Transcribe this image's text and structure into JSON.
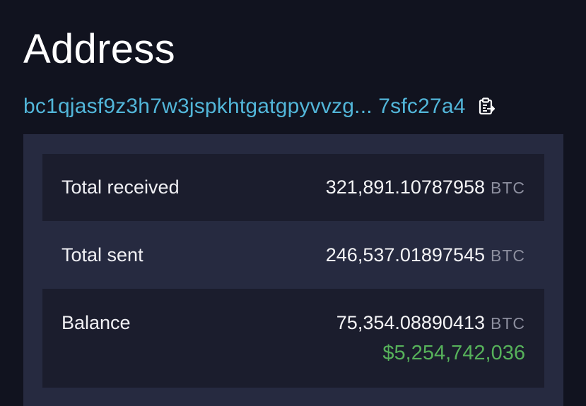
{
  "page": {
    "title": "Address",
    "address": {
      "text": "bc1qjasf9z3h7w3jspkhtgatgpyvvzg... 7sfc27a4",
      "copy_icon": "clipboard-copy-icon"
    }
  },
  "summary": {
    "total_received": {
      "label": "Total received",
      "value": "321,891.10787958",
      "unit": "BTC"
    },
    "total_sent": {
      "label": "Total sent",
      "value": "246,537.01897545",
      "unit": "BTC"
    },
    "balance": {
      "label": "Balance",
      "value": "75,354.08890413",
      "unit": "BTC",
      "usd_value": "$5,254,742,036"
    }
  },
  "colors": {
    "background": "#11131f",
    "card": "#262a40",
    "row_shaded": "#1b1d2d",
    "link": "#52b6d9",
    "usd_green": "#56b15a",
    "unit_gray": "#8d8f9f"
  }
}
